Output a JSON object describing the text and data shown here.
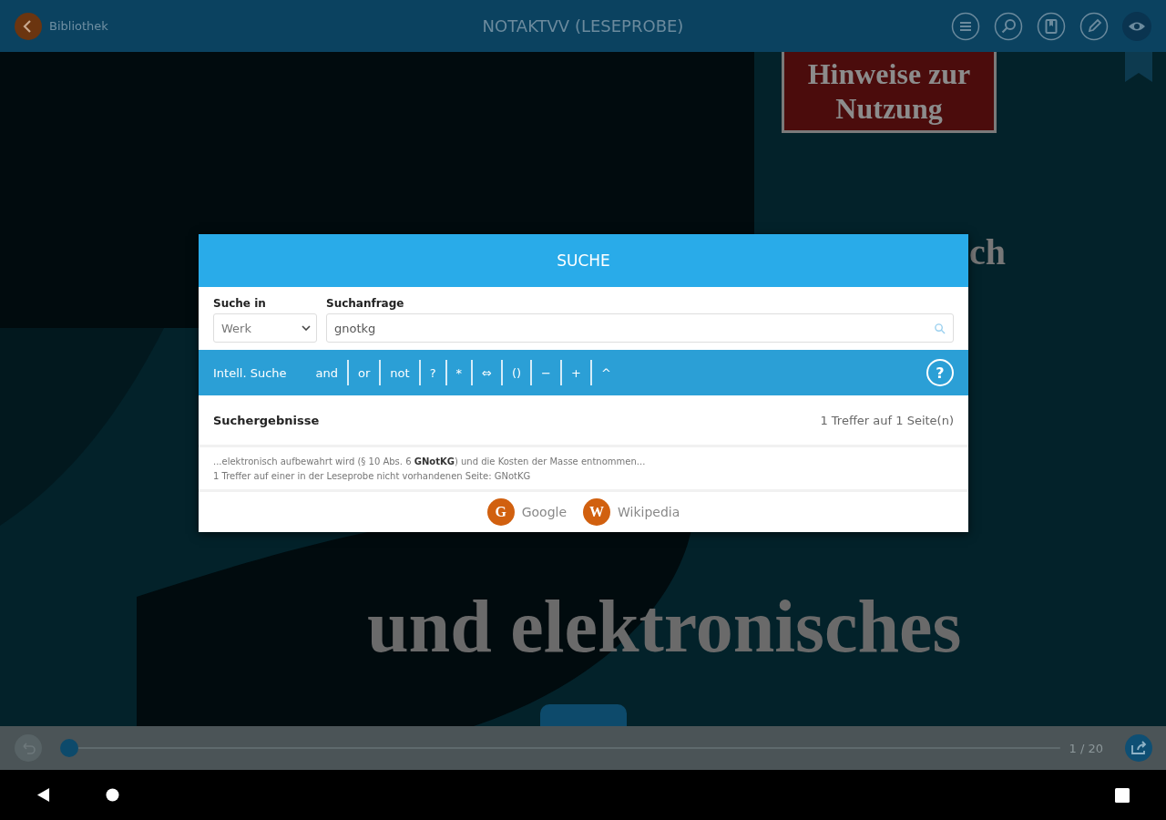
{
  "top_bar": {
    "back_label": "Bibliothek",
    "title": "NOTAKTVV (LESEPROBE)"
  },
  "cover": {
    "notice": "Hinweise zur Nutzung",
    "fragment": "ch",
    "lines": [
      "und elektronisches"
    ]
  },
  "search_dialog": {
    "title": "SUCHE",
    "scope_label": "Suche in",
    "scope_value": "Werk",
    "query_label": "Suchanfrage",
    "query_value": "gnotkg",
    "smart_search_label": "Intell. Suche",
    "operators": [
      "and",
      "or",
      "not",
      "?",
      "*",
      "⇔",
      "()",
      "−",
      "+",
      "^"
    ],
    "help_glyph": "?",
    "results_label": "Suchergebnisse",
    "results_count": "1 Treffer auf 1 Seite(n)",
    "results": [
      {
        "snippet": "...elektronisch aufbewahrt wird (§ 10 Abs. 6 **GNotKG**) und die Kosten der Masse entnommen...",
        "note": "1 Treffer auf einer in der Leseprobe nicht vorhandenen Seite: GNotKG"
      }
    ],
    "links": [
      {
        "letter": "G",
        "label": "Google"
      },
      {
        "letter": "W",
        "label": "Wikipedia"
      }
    ]
  },
  "footer": {
    "page": "1 / 20",
    "progress": {
      "level": 0
    }
  }
}
